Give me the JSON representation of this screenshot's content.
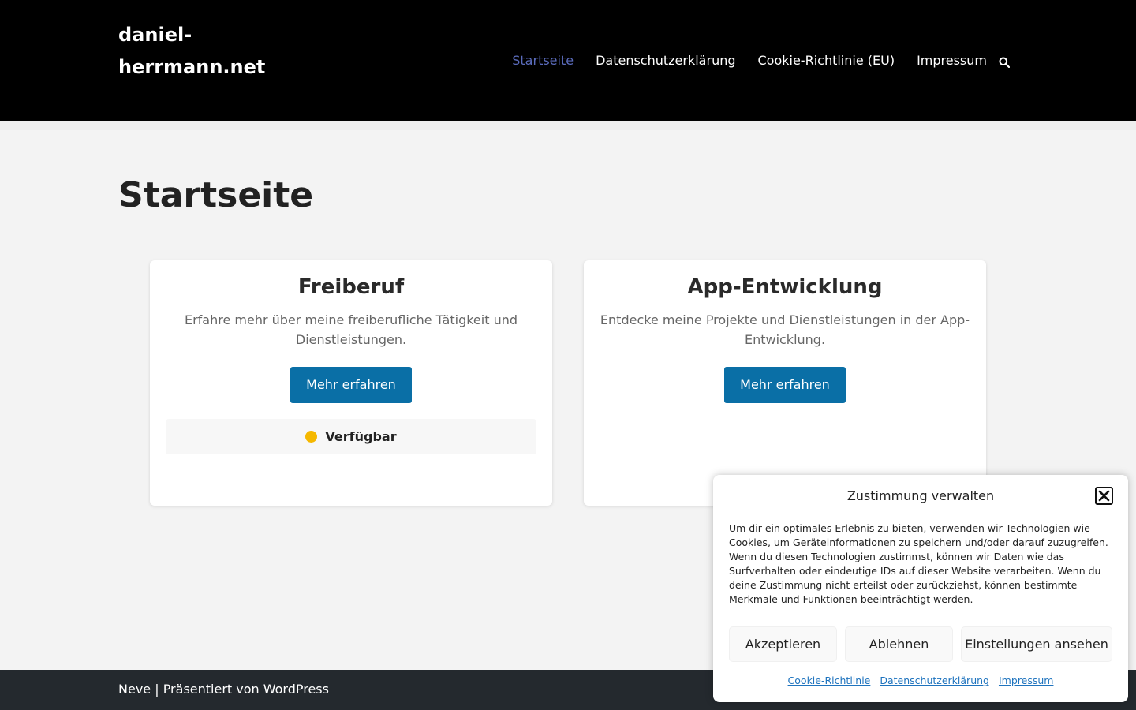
{
  "header": {
    "site_title": "daniel-herrmann.net",
    "nav": [
      {
        "label": "Startseite",
        "active": true
      },
      {
        "label": "Datenschutzerklärung",
        "active": false
      },
      {
        "label": "Cookie-Richtlinie (EU)",
        "active": false
      },
      {
        "label": "Impressum",
        "active": false
      }
    ],
    "search_icon": "search-icon"
  },
  "main": {
    "page_title": "Startseite",
    "cards": [
      {
        "title": "Freiberuf",
        "description": "Erfahre mehr über meine freiberufliche Tätigkeit und Dienstleistungen.",
        "button_label": "Mehr erfahren",
        "status": {
          "label": "Verfügbar",
          "color": "#f5b800"
        }
      },
      {
        "title": "App-Entwicklung",
        "description": "Entdecke meine Projekte und Dienstleistungen in der App-Entwicklung.",
        "button_label": "Mehr erfahren"
      }
    ]
  },
  "footer": {
    "theme": "Neve",
    "separator": " | ",
    "powered_by": "Präsentiert von WordPress"
  },
  "consent": {
    "title": "Zustimmung verwalten",
    "body": "Um dir ein optimales Erlebnis zu bieten, verwenden wir Technologien wie Cookies, um Geräteinformationen zu speichern und/oder darauf zuzugreifen. Wenn du diesen Technologien zustimmst, können wir Daten wie das Surfverhalten oder eindeutige IDs auf dieser Website verarbeiten. Wenn du deine Zustimmung nicht erteilst oder zurückziehst, können bestimmte Merkmale und Funktionen beeinträchtigt werden.",
    "buttons": {
      "accept": "Akzeptieren",
      "deny": "Ablehnen",
      "preferences": "Einstellungen ansehen"
    },
    "links": [
      "Cookie-Richtlinie",
      "Datenschutzerklärung",
      "Impressum"
    ]
  },
  "colors": {
    "header_bg": "#000000",
    "page_bg": "#f3f3f3",
    "accent_nav": "#5b6cbd",
    "button": "#0a6fa6",
    "footer_bg": "#24292e",
    "link": "#1e73be"
  }
}
